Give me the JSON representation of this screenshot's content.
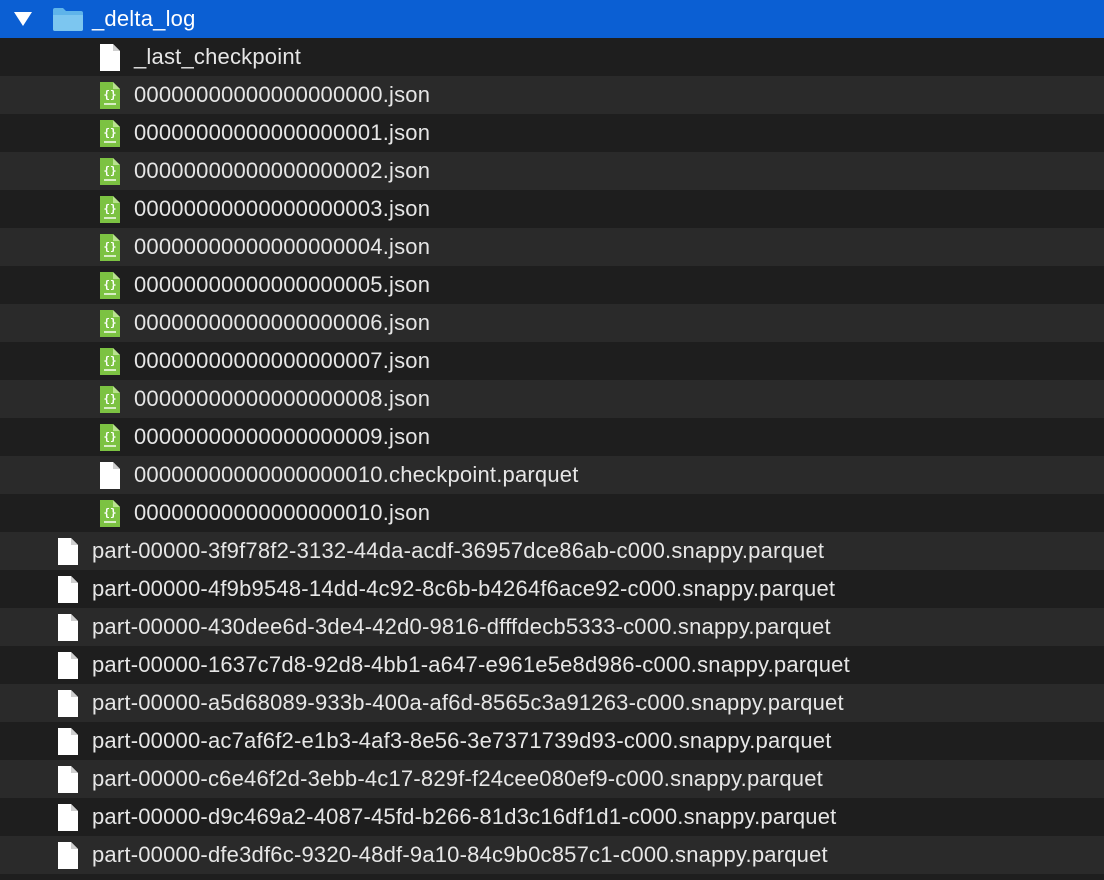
{
  "root": {
    "name": "_delta_log",
    "expanded": true,
    "icon": "folder-icon",
    "children": [
      {
        "name": "_last_checkpoint",
        "icon": "document-icon"
      },
      {
        "name": "00000000000000000000.json",
        "icon": "json-file-icon"
      },
      {
        "name": "00000000000000000001.json",
        "icon": "json-file-icon"
      },
      {
        "name": "00000000000000000002.json",
        "icon": "json-file-icon"
      },
      {
        "name": "00000000000000000003.json",
        "icon": "json-file-icon"
      },
      {
        "name": "00000000000000000004.json",
        "icon": "json-file-icon"
      },
      {
        "name": "00000000000000000005.json",
        "icon": "json-file-icon"
      },
      {
        "name": "00000000000000000006.json",
        "icon": "json-file-icon"
      },
      {
        "name": "00000000000000000007.json",
        "icon": "json-file-icon"
      },
      {
        "name": "00000000000000000008.json",
        "icon": "json-file-icon"
      },
      {
        "name": "00000000000000000009.json",
        "icon": "json-file-icon"
      },
      {
        "name": "00000000000000000010.checkpoint.parquet",
        "icon": "document-icon"
      },
      {
        "name": "00000000000000000010.json",
        "icon": "json-file-icon"
      }
    ]
  },
  "files": [
    {
      "name": "part-00000-3f9f78f2-3132-44da-acdf-36957dce86ab-c000.snappy.parquet",
      "icon": "document-icon"
    },
    {
      "name": "part-00000-4f9b9548-14dd-4c92-8c6b-b4264f6ace92-c000.snappy.parquet",
      "icon": "document-icon"
    },
    {
      "name": "part-00000-430dee6d-3de4-42d0-9816-dfffdecb5333-c000.snappy.parquet",
      "icon": "document-icon"
    },
    {
      "name": "part-00000-1637c7d8-92d8-4bb1-a647-e961e5e8d986-c000.snappy.parquet",
      "icon": "document-icon"
    },
    {
      "name": "part-00000-a5d68089-933b-400a-af6d-8565c3a91263-c000.snappy.parquet",
      "icon": "document-icon"
    },
    {
      "name": "part-00000-ac7af6f2-e1b3-4af3-8e56-3e7371739d93-c000.snappy.parquet",
      "icon": "document-icon"
    },
    {
      "name": "part-00000-c6e46f2d-3ebb-4c17-829f-f24cee080ef9-c000.snappy.parquet",
      "icon": "document-icon"
    },
    {
      "name": "part-00000-d9c469a2-4087-45fd-b266-81d3c16df1d1-c000.snappy.parquet",
      "icon": "document-icon"
    },
    {
      "name": "part-00000-dfe3df6c-9320-48df-9a10-84c9b0c857c1-c000.snappy.parquet",
      "icon": "document-icon"
    }
  ],
  "colors": {
    "selection": "#0b5fd3",
    "row_dark": "#1e1e1e",
    "row_light": "#2a2a2a",
    "json_icon_green": "#7cc242",
    "folder_blue": "#5fb4ea"
  }
}
